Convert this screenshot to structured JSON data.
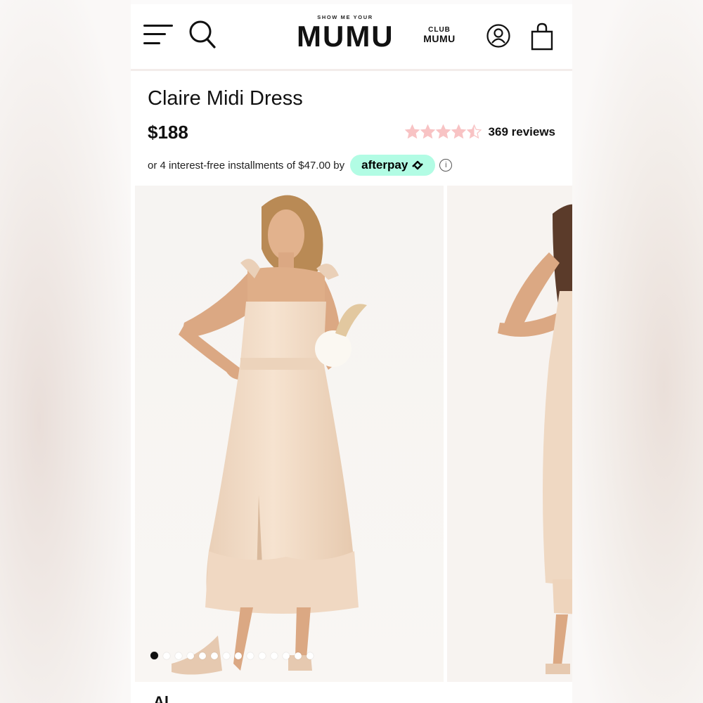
{
  "header": {
    "logo_small": "SHOW ME YOUR",
    "logo_big": "MUMU",
    "club_top": "CLUB",
    "club_bottom": "MUMU",
    "icons": [
      "menu-icon",
      "search-icon",
      "account-icon",
      "shopping-bag-icon"
    ]
  },
  "product": {
    "title": "Claire Midi Dress",
    "price": "$188",
    "rating": 4.5,
    "rating_max": 5,
    "reviews": "369 reviews",
    "installments_text": "or 4 interest-free installments of $47.00 by",
    "afterpay_label": "afterpay",
    "info_symbol": "i"
  },
  "gallery": {
    "dot_count": 14,
    "active_index": 0
  },
  "colors": {
    "star": "#f8c3c4",
    "afterpay": "#b2fce4",
    "dress": "#f0d9c4",
    "text": "#111111"
  },
  "footer_partial": "Al"
}
